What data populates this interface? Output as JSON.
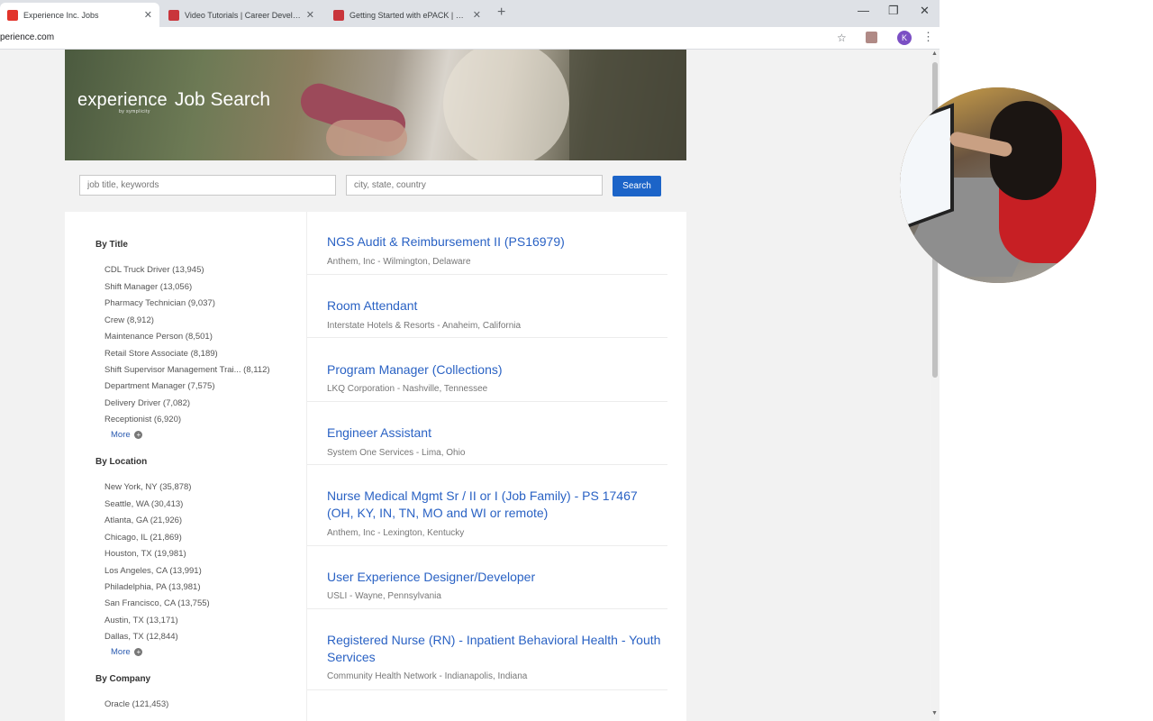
{
  "browser": {
    "tabs": [
      {
        "title": "Experience Inc. Jobs",
        "active": true,
        "favicon_color": "#e2342b"
      },
      {
        "title": "Video Tutorials | Career Developm",
        "active": false,
        "favicon_color": "#c9353b"
      },
      {
        "title": "Getting Started with ePACK | Care",
        "active": false,
        "favicon_color": "#c9353b"
      }
    ],
    "new_tab": "+",
    "close_glyph": "✕",
    "window_controls": {
      "minimize": "—",
      "restore": "❐",
      "close": "✕"
    },
    "url": "perience.com",
    "profile_initial": "K",
    "bookmark_icon": "☆",
    "menu_icon": "⋮"
  },
  "hero": {
    "brand": "experience",
    "brand_by": "by symplicity",
    "subtitle": "Job Search"
  },
  "search": {
    "keywords_placeholder": "job title, keywords",
    "location_placeholder": "city, state, country",
    "button_label": "Search"
  },
  "facets": {
    "by_title": {
      "heading": "By Title",
      "items": [
        "CDL Truck Driver (13,945)",
        "Shift Manager (13,056)",
        "Pharmacy Technician (9,037)",
        "Crew (8,912)",
        "Maintenance Person (8,501)",
        "Retail Store Associate (8,189)",
        "Shift Supervisor Management Trai... (8,112)",
        "Department Manager (7,575)",
        "Delivery Driver (7,082)",
        "Receptionist (6,920)"
      ],
      "more": "More"
    },
    "by_location": {
      "heading": "By Location",
      "items": [
        "New York, NY (35,878)",
        "Seattle, WA (30,413)",
        "Atlanta, GA (21,926)",
        "Chicago, IL (21,869)",
        "Houston, TX (19,981)",
        "Los Angeles, CA (13,991)",
        "Philadelphia, PA (13,981)",
        "San Francisco, CA (13,755)",
        "Austin, TX (13,171)",
        "Dallas, TX (12,844)"
      ],
      "more": "More"
    },
    "by_company": {
      "heading": "By Company",
      "items": [
        "Oracle (121,453)"
      ]
    }
  },
  "results": [
    {
      "title": "NGS Audit & Reimbursement II (PS16979)",
      "subtitle": "Anthem, Inc - Wilmington, Delaware"
    },
    {
      "title": "Room Attendant",
      "subtitle": "Interstate Hotels & Resorts - Anaheim, California"
    },
    {
      "title": "Program Manager (Collections)",
      "subtitle": "LKQ Corporation - Nashville, Tennessee"
    },
    {
      "title": "Engineer Assistant",
      "subtitle": "System One Services - Lima, Ohio"
    },
    {
      "title": "Nurse Medical Mgmt Sr / II or I (Job Family) - PS 17467 (OH, KY, IN, TN, MO and WI or remote)",
      "subtitle": "Anthem, Inc - Lexington, Kentucky"
    },
    {
      "title": "User Experience Designer/Developer",
      "subtitle": "USLI - Wayne, Pennsylvania"
    },
    {
      "title": "Registered Nurse (RN) - Inpatient Behavioral Health - Youth Services",
      "subtitle": "Community Health Network - Indianapolis, Indiana"
    }
  ]
}
